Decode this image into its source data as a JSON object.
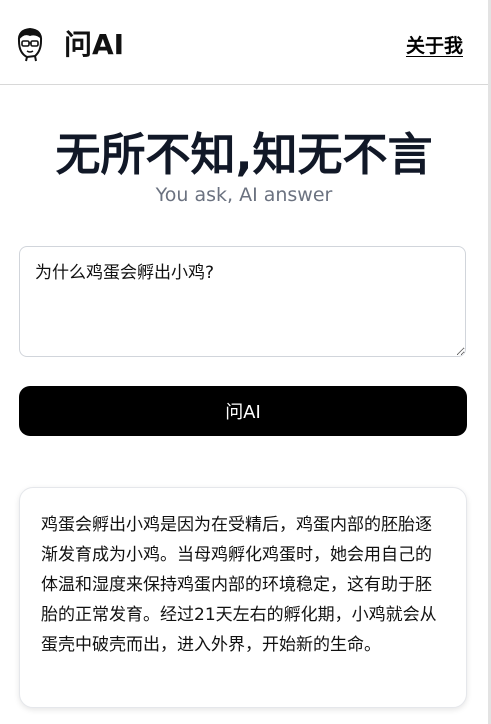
{
  "header": {
    "logo_icon": "cartoon-face-icon",
    "brand": "问AI",
    "about_link": "关于我"
  },
  "hero": {
    "title": "无所不知,知无不言",
    "subtitle": "You ask, AI answer"
  },
  "question": {
    "value": "为什么鸡蛋会孵出小鸡?"
  },
  "ask_button": {
    "label": "问AI"
  },
  "answer": {
    "text": "鸡蛋会孵出小鸡是因为在受精后，鸡蛋内部的胚胎逐渐发育成为小鸡。当母鸡孵化鸡蛋时，她会用自己的体温和湿度来保持鸡蛋内部的环境稳定，这有助于胚胎的正常发育。经过21天左右的孵化期，小鸡就会从蛋壳中破壳而出，进入外界，开始新的生命。"
  }
}
